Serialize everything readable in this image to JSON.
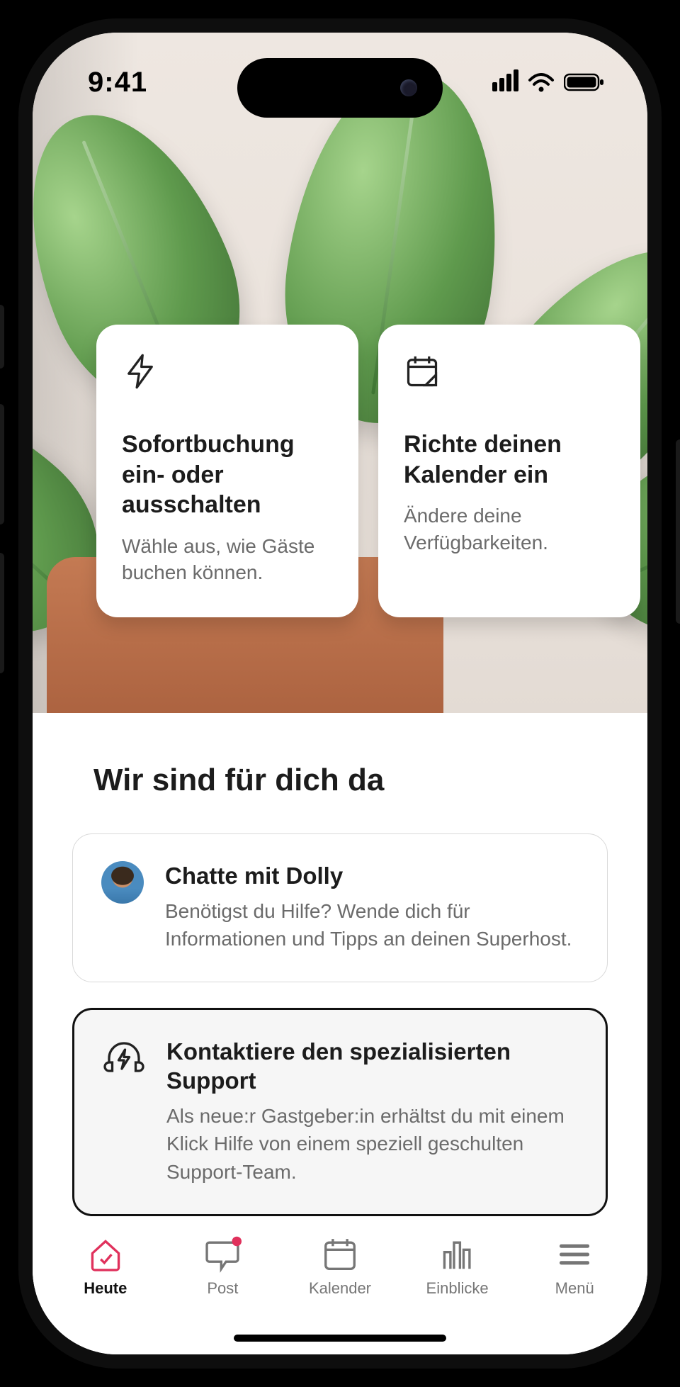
{
  "status": {
    "time": "9:41"
  },
  "cards": [
    {
      "title": "Sofortbuchung ein- oder ausschalten",
      "sub": "Wähle aus, wie Gäste buchen können."
    },
    {
      "title": "Richte deinen Kalender ein",
      "sub": "Ändere deine Verfügbarkeiten."
    }
  ],
  "section_title": "Wir sind für dich da",
  "help": [
    {
      "title": "Chatte mit Dolly",
      "sub": "Benötigst du Hilfe? Wende dich für Informationen und Tipps an deinen Superhost."
    },
    {
      "title": "Kontaktiere den spezialisierten Support",
      "sub": "Als neue:r Gastgeber:in erhältst du mit einem Klick Hilfe von einem speziell geschulten Support-Team."
    }
  ],
  "tabs": [
    {
      "label": "Heute"
    },
    {
      "label": "Post"
    },
    {
      "label": "Kalender"
    },
    {
      "label": "Einblicke"
    },
    {
      "label": "Menü"
    }
  ]
}
